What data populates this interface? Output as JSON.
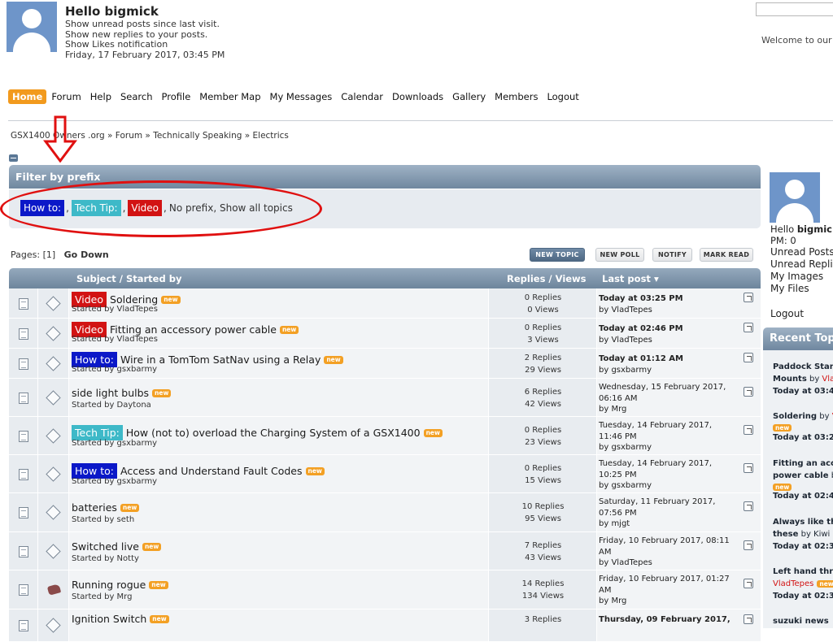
{
  "header": {
    "greeting": "Hello bigmick",
    "links": [
      "Show unread posts since last visit.",
      "Show new replies to your posts.",
      "Show Likes notification"
    ],
    "datetime": "Friday, 17 February 2017, 03:45 PM",
    "welcome": "Welcome to our"
  },
  "menu": [
    "Home",
    "Forum",
    "Help",
    "Search",
    "Profile",
    "Member Map",
    "My Messages",
    "Calendar",
    "Downloads",
    "Gallery",
    "Members",
    "Logout"
  ],
  "breadcrumb": "GSX1400 Owners .org » Forum » Technically Speaking » Electrics",
  "filter": {
    "title": "Filter by prefix",
    "howto": "How to:",
    "techtip": "Tech Tip:",
    "video": "Video",
    "no_prefix": "No prefix,",
    "show_all": "Show all topics"
  },
  "pagination": {
    "label": "Pages: [1]",
    "go_down": "Go Down"
  },
  "buttons": {
    "new_topic": "New Topic",
    "new_poll": "New Poll",
    "notify": "Notify",
    "mark_read": "Mark Read"
  },
  "table": {
    "col_subject": "Subject / Started by",
    "col_replies": "Replies / Views",
    "col_last": "Last post",
    "new_badge": "new",
    "rows": [
      {
        "prefix": "Video",
        "title": "Soldering",
        "by": "Started by VladTepes",
        "replies": "0 Replies",
        "views": "0 Views",
        "last1": "Today at 03:25 PM",
        "last2": "by VladTepes",
        "last3": ""
      },
      {
        "prefix": "Video",
        "title": "Fitting an accessory power cable",
        "by": "Started by VladTepes",
        "replies": "0 Replies",
        "views": "3 Views",
        "last1": "Today at 02:46 PM",
        "last2": "by VladTepes",
        "last3": ""
      },
      {
        "prefix": "How to:",
        "title": "Wire in a TomTom SatNav using a Relay",
        "by": "Started by gsxbarmy",
        "replies": "2 Replies",
        "views": "29 Views",
        "last1": "Today at 01:12 AM",
        "last2": "by gsxbarmy",
        "last3": ""
      },
      {
        "prefix": "",
        "title": "side light bulbs",
        "by": "Started by Daytona",
        "replies": "6 Replies",
        "views": "42 Views",
        "last1": "Wednesday, 15 February 2017,",
        "last2": "06:16 AM",
        "last3": "by Mrg"
      },
      {
        "prefix": "Tech Tip:",
        "title": "How (not to) overload the Charging System of a GSX1400",
        "by": "Started by gsxbarmy",
        "replies": "0 Replies",
        "views": "23 Views",
        "last1": "Tuesday, 14 February 2017,",
        "last2": "11:46 PM",
        "last3": "by gsxbarmy"
      },
      {
        "prefix": "How to:",
        "title": "Access and Understand Fault Codes",
        "by": "Started by gsxbarmy",
        "replies": "0 Replies",
        "views": "15 Views",
        "last1": "Tuesday, 14 February 2017,",
        "last2": "10:25 PM",
        "last3": "by gsxbarmy"
      },
      {
        "prefix": "",
        "title": "batteries",
        "by": "Started by seth",
        "replies": "10 Replies",
        "views": "95 Views",
        "last1": "Saturday, 11 February 2017,",
        "last2": "07:56 PM",
        "last3": "by mjgt"
      },
      {
        "prefix": "",
        "title": "Switched live",
        "by": "Started by Notty",
        "replies": "7 Replies",
        "views": "43 Views",
        "last1": "Friday, 10 February 2017, 08:11",
        "last2": "AM",
        "last3": "by VladTepes"
      },
      {
        "prefix": "",
        "title": "Running rogue",
        "by": "Started by Mrg",
        "replies": "14 Replies",
        "views": "134 Views",
        "last1": "Friday, 10 February 2017, 01:27",
        "last2": "AM",
        "last3": "by Mrg"
      },
      {
        "prefix": "",
        "title": "Ignition Switch",
        "by": "",
        "replies": "3 Replies",
        "views": "",
        "last1": "Thursday, 09 February 2017,",
        "last2": "",
        "last3": ""
      }
    ]
  },
  "sidebar": {
    "greeting_prefix": "Hello ",
    "greeting_name": "bigmic",
    "pm": "PM: 0",
    "links": [
      "Unread Posts",
      "Unread Replie",
      "My Images",
      "My Files"
    ],
    "logout": "Logout",
    "recent_title": "Recent Top",
    "recent": [
      {
        "l1": "Paddock Stan",
        "l2a": "Mounts",
        "l2b": " by ",
        "l2c": "Vla",
        "time": "Today at 03:4"
      },
      {
        "l1": "Soldering",
        "l1b": " by ",
        "l1c": "V",
        "time": "Today at 03:2"
      },
      {
        "l1": "Fitting an acc",
        "l2a": "power cable",
        "l2b": " b",
        "time": "Today at 02:4"
      },
      {
        "l1": "Always like th",
        "l2a": "these",
        "l2b": " by Kiwi",
        "time": "Today at 02:3"
      },
      {
        "l1": "Left hand thr",
        "l2c": "VladTepes",
        "time": "Today at 02:3"
      },
      {
        "l1": "suzuki news"
      }
    ]
  }
}
